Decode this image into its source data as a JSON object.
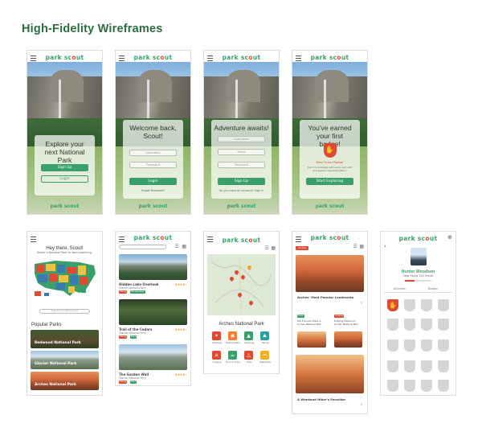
{
  "page_title": "High-Fidelity Wireframes",
  "brand": {
    "logo_word1": "park sc",
    "logo_o": "o",
    "logo_word2": "ut",
    "green": "#3aa06a",
    "red": "#e04a32"
  },
  "screens": {
    "explore": {
      "heading": "Explore your next National Park",
      "signup": "Sign Up",
      "login": "Login",
      "footer_logo": "park scout"
    },
    "welcome": {
      "heading": "Welcome back, Scout!",
      "username": "Username",
      "password": "Password",
      "login": "Login",
      "forgot": "Forgot Password?",
      "footer_logo": "park scout"
    },
    "adventure": {
      "heading": "Adventure awaits!",
      "username": "Username",
      "email": "Email",
      "password": "Password",
      "signup": "Sign Up",
      "already": "Do you have an account? Sign In",
      "footer_logo": "park scout"
    },
    "badge": {
      "heading": "You've earned your first badge!",
      "badge_name": "New Scout Badge",
      "badge_desc": "Earn more badges with every park visit and explore new destinations.",
      "cta": "Start Exploring",
      "footer_logo": "park scout"
    },
    "home": {
      "greeting": "Hey there, Scout!",
      "subtitle": "Select a National Park to start exploring.",
      "search_placeholder": "Search for a national park",
      "popular_title": "Popular Parks",
      "parks": [
        "Redwood National Park",
        "Glacier National Park",
        "Arches National Park"
      ]
    },
    "list": {
      "items": [
        {
          "title": "Hidden Lake Overlook",
          "sub": "Glacier National Park",
          "tags": [
            "Hiking",
            "Photography"
          ]
        },
        {
          "title": "Trail of the Cedars",
          "sub": "Glacier National Park",
          "tags": [
            "Hiking",
            "Easy"
          ]
        },
        {
          "title": "The Garden Wall",
          "sub": "Glacier National Park",
          "tags": [
            "Hiking",
            "Hard"
          ]
        }
      ]
    },
    "map": {
      "title": "Arches National Park",
      "categories": [
        "Activities",
        "Photography",
        "Camping",
        "Hiking",
        "Lodging",
        "Food & Drink",
        "Trails",
        "Waterfalls"
      ]
    },
    "feed": {
      "chip": "Arches",
      "top_title": "Arches' Most Popular Landmarks",
      "mid_tags": [
        "Trails",
        "Lodging"
      ],
      "mid_titles": [
        "Top 5 Scenic Trails in Arches National Park",
        "Lodging Options in Arches National Park"
      ],
      "bottom_title": "A Weekend Hiker's Paradise"
    },
    "profile": {
      "name": "Hunter Woodson",
      "level": "New Scout",
      "points": "120 Points",
      "tabs": [
        "Activities",
        "Badges"
      ],
      "progress": 0.35
    }
  }
}
